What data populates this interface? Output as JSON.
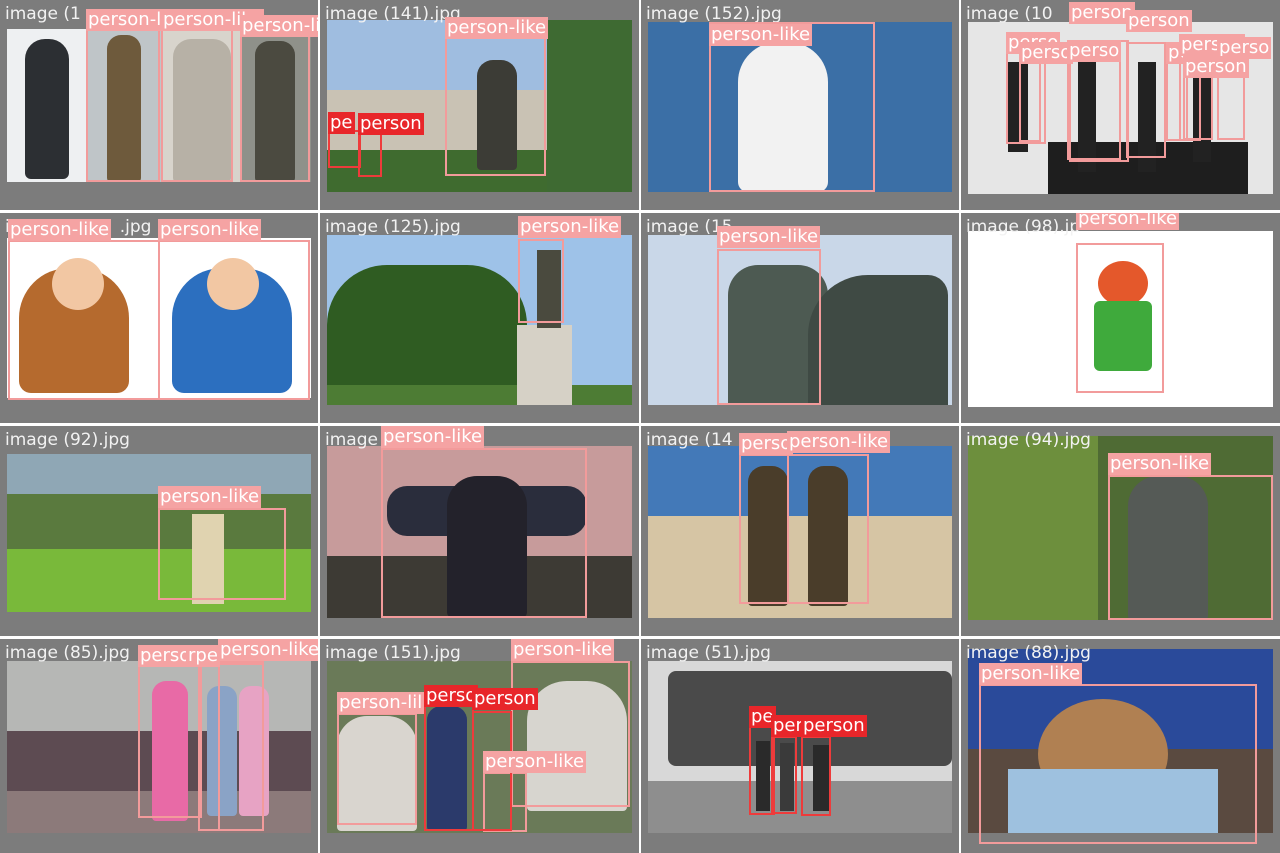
{
  "grid": {
    "cells": [
      {
        "filename": "image (1",
        "labels": [
          "person-like",
          "person-like",
          "person-like"
        ]
      },
      {
        "filename": "image (141).jpg",
        "labels": [
          "person-like",
          "pe",
          "person"
        ]
      },
      {
        "filename": "image (152).jpg",
        "labels": [
          "person-like"
        ]
      },
      {
        "filename": "image (10",
        "labels": [
          "perso",
          "perso",
          "person",
          "perso",
          "person",
          "perso",
          "person",
          "perso",
          "person"
        ]
      },
      {
        "filename": "i",
        "labels": [
          "person-like",
          "person-like"
        ],
        "filename_tail": ".jpg"
      },
      {
        "filename": "image (125).jpg",
        "labels": [
          "person-like"
        ]
      },
      {
        "filename": "image (15",
        "labels": [
          "person-like"
        ]
      },
      {
        "filename": "image (98).jp",
        "labels": [
          "person-like"
        ]
      },
      {
        "filename": "image (92).jpg",
        "labels": [
          "person-like"
        ]
      },
      {
        "filename": "image",
        "labels": [
          "person-like"
        ]
      },
      {
        "filename": "image (14",
        "labels": [
          "perso",
          "person-like"
        ]
      },
      {
        "filename": "image (94).jpg",
        "labels": [
          "person-like"
        ]
      },
      {
        "filename": "image (85).jpg",
        "labels": [
          "perso",
          "rpe",
          "person-like"
        ]
      },
      {
        "filename": "image (151).jpg",
        "labels": [
          "person-like",
          "person-like",
          "perso",
          "person",
          "person-lil"
        ]
      },
      {
        "filename": "image (51).jpg",
        "labels": [
          "pe",
          "per",
          "person"
        ]
      },
      {
        "filename": "image (88).jpg",
        "labels": [
          "person-like"
        ]
      }
    ]
  },
  "colors": {
    "box": "#f29b9b",
    "box_strong": "#ee3b3b",
    "label_bg": "#f5a3a3",
    "label_bg_strong": "#e8262a",
    "cell_bg": "#7c7c7c"
  }
}
